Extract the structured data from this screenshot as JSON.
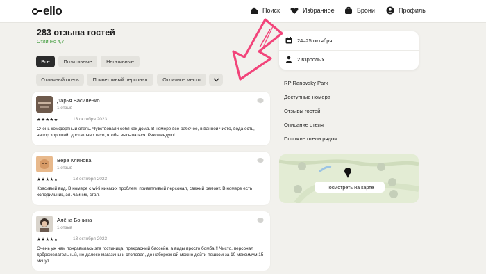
{
  "header": {
    "logo": "ostrovok-style logo",
    "brand": "ello",
    "nav": [
      {
        "label": "Поиск",
        "icon": "home-icon"
      },
      {
        "label": "Избранное",
        "icon": "heart-icon"
      },
      {
        "label": "Брони",
        "icon": "suitcase-icon"
      },
      {
        "label": "Профиль",
        "icon": "user-icon"
      }
    ]
  },
  "reviews_section": {
    "title": "283 отзыва гостей",
    "rating": "Отлично 4,7",
    "filters": [
      "Все",
      "Позитивные",
      "Негативные"
    ],
    "tags": [
      "Отличный отель",
      "Приветливый персонал",
      "Отличное место"
    ]
  },
  "reviews": [
    {
      "name": "Дарья Василенко",
      "count": "1 отзыв",
      "stars": "★★★★★",
      "date": "13 октября 2023",
      "text": "Очень комфортный отель. Чувствовали себя как дома. В номере все рабочее, в ванной чисто, вода есть, напор хороший, достаточно тихо, чтобы высыпаться. Рекомендую!"
    },
    {
      "name": "Вера Клинова",
      "count": "1 отзыв",
      "stars": "★★★★★",
      "date": "13 октября 2023",
      "text": "Красивый вид. В номере с wi-fi никаких проблем, приветливый персонал, свежий ремонт. В номере есть холодильник, эл. чайник, стол."
    },
    {
      "name": "Алёна Бонина",
      "count": "1 отзыв",
      "stars": "★★★★★",
      "date": "13 октября 2023",
      "text": "Очень уж нам понравилась эта гостиница, прекрасный бассейн, а виды просто бомба!!! Чисто, персонал доброжелательный, не далеко магазины и столовая, до набережной можно дойти пешком за 10 максимум 15 минут"
    }
  ],
  "booking": {
    "dates": "24–25 октября",
    "guests": "2 взрослых"
  },
  "sidebar": {
    "links": [
      "RP Ranovsky Park",
      "Доступные номера",
      "Отзывы гостей",
      "Описание отеля",
      "Похожие отели рядом"
    ],
    "map_button": "Посмотреть на карте"
  },
  "colors": {
    "accent_green": "#3e9a3a",
    "arrow_pink": "#f2447a",
    "background": "#f2f1ed"
  }
}
